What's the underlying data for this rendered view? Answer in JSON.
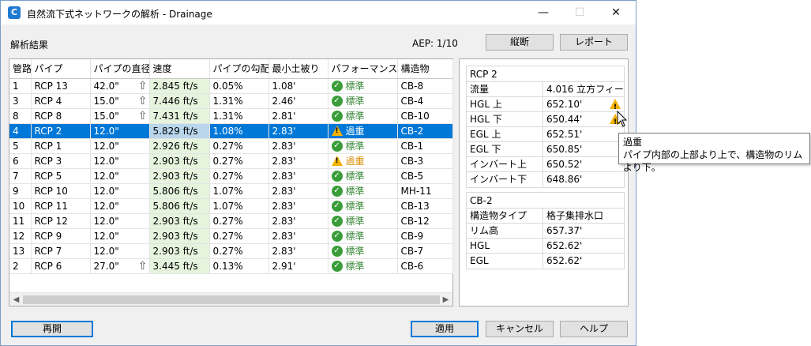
{
  "window": {
    "title": "自然流下式ネットワークの解析 - Drainage",
    "icon_letter": "C",
    "minimize": "—",
    "maximize": "☐",
    "close": "✕"
  },
  "header": {
    "results_label": "解析結果",
    "aep": "AEP: 1/10",
    "profile_button": "縦断",
    "report_button": "レポート"
  },
  "grid": {
    "columns": [
      "管路",
      "パイプ",
      "パイプの直径",
      "速度",
      "パイプの勾配",
      "最小土被り",
      "パフォーマンス",
      "構造物"
    ],
    "rows": [
      {
        "no": "1",
        "pipe": "RCP 13",
        "diameter": "42.0\"",
        "arrow": true,
        "speed": "2.845 ft/s",
        "slope": "0.05%",
        "cover": "1.08'",
        "status": "標準",
        "kind": "ok",
        "structure": "CB-8"
      },
      {
        "no": "3",
        "pipe": "RCP 4",
        "diameter": "15.0\"",
        "arrow": true,
        "speed": "7.446 ft/s",
        "slope": "1.31%",
        "cover": "2.46'",
        "status": "標準",
        "kind": "ok",
        "structure": "CB-4"
      },
      {
        "no": "8",
        "pipe": "RCP 8",
        "diameter": "15.0\"",
        "arrow": true,
        "speed": "7.431 ft/s",
        "slope": "1.31%",
        "cover": "2.81'",
        "status": "標準",
        "kind": "ok",
        "structure": "CB-10"
      },
      {
        "no": "4",
        "pipe": "RCP 2",
        "diameter": "12.0\"",
        "arrow": false,
        "speed": "5.829 ft/s",
        "slope": "1.08%",
        "cover": "2.83'",
        "status": "過重",
        "kind": "warn",
        "structure": "CB-2",
        "selected": true
      },
      {
        "no": "5",
        "pipe": "RCP 1",
        "diameter": "12.0\"",
        "arrow": false,
        "speed": "2.926 ft/s",
        "slope": "0.27%",
        "cover": "2.83'",
        "status": "標準",
        "kind": "ok",
        "structure": "CB-1"
      },
      {
        "no": "6",
        "pipe": "RCP 3",
        "diameter": "12.0\"",
        "arrow": false,
        "speed": "2.903 ft/s",
        "slope": "0.27%",
        "cover": "2.83'",
        "status": "過重",
        "kind": "warn",
        "structure": "CB-3"
      },
      {
        "no": "7",
        "pipe": "RCP 5",
        "diameter": "12.0\"",
        "arrow": false,
        "speed": "2.903 ft/s",
        "slope": "0.27%",
        "cover": "2.83'",
        "status": "標準",
        "kind": "ok",
        "structure": "CB-5"
      },
      {
        "no": "9",
        "pipe": "RCP 10",
        "diameter": "12.0\"",
        "arrow": false,
        "speed": "5.806 ft/s",
        "slope": "1.07%",
        "cover": "2.83'",
        "status": "標準",
        "kind": "ok",
        "structure": "MH-11"
      },
      {
        "no": "10",
        "pipe": "RCP 11",
        "diameter": "12.0\"",
        "arrow": false,
        "speed": "5.806 ft/s",
        "slope": "1.07%",
        "cover": "2.83'",
        "status": "標準",
        "kind": "ok",
        "structure": "CB-13"
      },
      {
        "no": "11",
        "pipe": "RCP 12",
        "diameter": "12.0\"",
        "arrow": false,
        "speed": "2.903 ft/s",
        "slope": "0.27%",
        "cover": "2.83'",
        "status": "標準",
        "kind": "ok",
        "structure": "CB-12"
      },
      {
        "no": "12",
        "pipe": "RCP 9",
        "diameter": "12.0\"",
        "arrow": false,
        "speed": "2.903 ft/s",
        "slope": "0.27%",
        "cover": "2.83'",
        "status": "標準",
        "kind": "ok",
        "structure": "CB-9"
      },
      {
        "no": "13",
        "pipe": "RCP 7",
        "diameter": "12.0\"",
        "arrow": false,
        "speed": "2.903 ft/s",
        "slope": "0.27%",
        "cover": "2.83'",
        "status": "標準",
        "kind": "ok",
        "structure": "CB-7"
      },
      {
        "no": "2",
        "pipe": "RCP 6",
        "diameter": "27.0\"",
        "arrow": true,
        "speed": "3.445 ft/s",
        "slope": "0.13%",
        "cover": "2.91'",
        "status": "標準",
        "kind": "ok",
        "structure": "CB-6"
      }
    ]
  },
  "pipe_props": {
    "title": "RCP 2",
    "rows": [
      {
        "key": "流量",
        "value": "4.016 立方フィー…",
        "warn": false
      },
      {
        "key": "HGL 上",
        "value": "652.10'",
        "warn": true
      },
      {
        "key": "HGL 下",
        "value": "650.44'",
        "warn": true
      },
      {
        "key": "EGL 上",
        "value": "652.51'",
        "warn": false
      },
      {
        "key": "EGL 下",
        "value": "650.85'",
        "warn": false
      },
      {
        "key": "インバート上",
        "value": "650.52'",
        "warn": false
      },
      {
        "key": "インバート下",
        "value": "648.86'",
        "warn": false
      }
    ]
  },
  "structure_props": {
    "title": "CB-2",
    "rows": [
      {
        "key": "構造物タイプ",
        "value": "格子集排水口"
      },
      {
        "key": "リム高",
        "value": "657.37'"
      },
      {
        "key": "HGL",
        "value": "652.62'"
      },
      {
        "key": "EGL",
        "value": "652.62'"
      }
    ]
  },
  "tooltip": {
    "title": "過重",
    "text": "パイプ内部の上部より上で、構造物のリムより下。"
  },
  "footer": {
    "reopen": "再開",
    "apply": "適用",
    "cancel": "キャンセル",
    "help": "ヘルプ"
  }
}
